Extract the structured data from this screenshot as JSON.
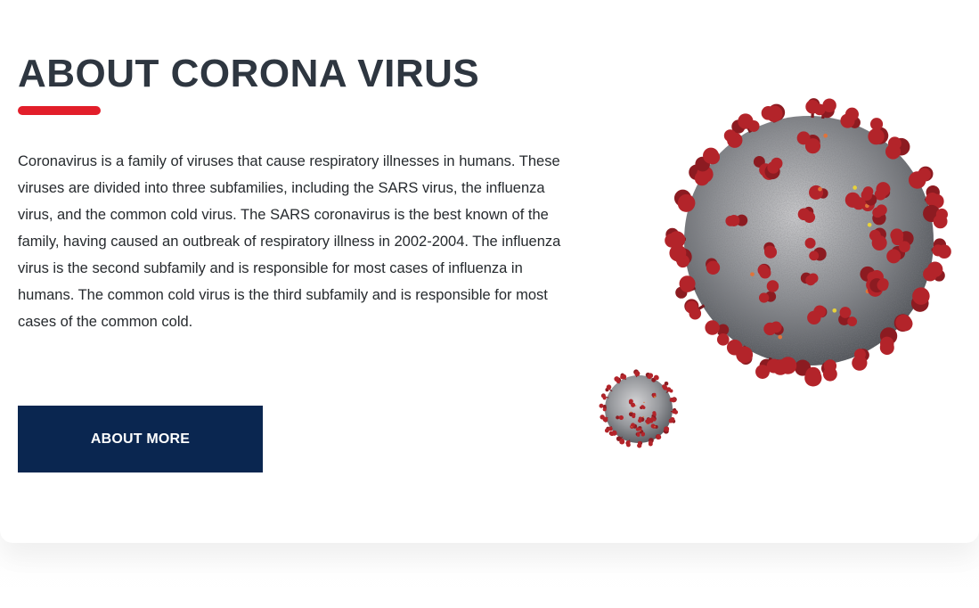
{
  "section": {
    "title": "ABOUT CORONA VIRUS",
    "description": "Coronavirus is a family of viruses that cause respiratory illnesses in humans. These viruses are divided into three subfamilies, including the SARS virus, the influenza virus, and the common cold virus. The SARS coronavirus is the best known of the family, having caused an outbreak of respiratory illness in 2002-2004. The influenza virus is the second subfamily and is responsible for most cases of influenza in humans. The common cold virus is the third subfamily and is responsible for most cases of the common cold.",
    "button_label": "ABOUT MORE"
  },
  "images": {
    "large": "coronavirus-illustration",
    "small": "coronavirus-illustration-small"
  },
  "colors": {
    "title": "#2e3640",
    "accent": "#e21e2a",
    "button": "#0a2650",
    "spike": "#b3242a",
    "body": "#8e9094"
  }
}
